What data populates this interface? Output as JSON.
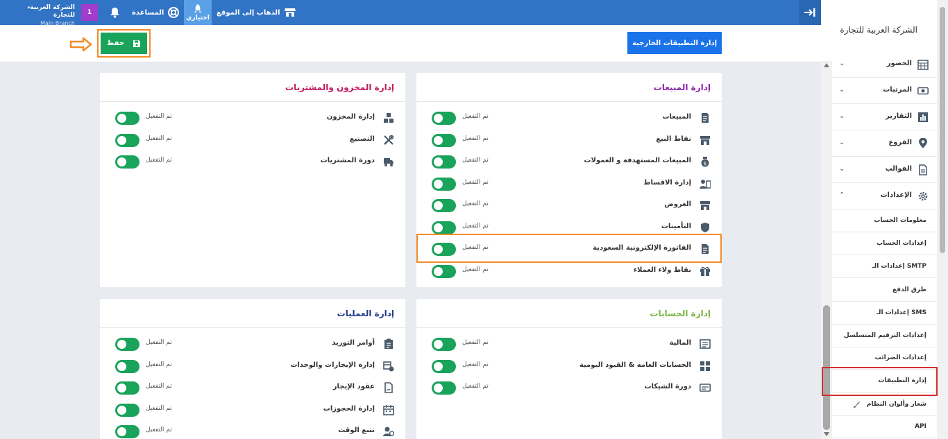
{
  "topbar": {
    "company": "الشركة العربية للتجارة",
    "branch": "Main Branch",
    "badge": "1",
    "help": "المساعدة",
    "mine": "اختياري",
    "goto_site": "الذهاب إلى الموقع"
  },
  "toolbar": {
    "save_label": "حفظ",
    "external_apps_label": "إدارة التطبيقات الخارجية"
  },
  "status_enabled": "تم التفعيل",
  "cards": {
    "sales": {
      "title": "إدارة المبيعات",
      "title_color": "#8e24aa",
      "items": [
        {
          "label": "المبيعات",
          "status": "تم التفعيل",
          "icon": "receipt-icon"
        },
        {
          "label": "نقاط البيع",
          "status": "تم التفعيل",
          "icon": "store-icon"
        },
        {
          "label": "المبيعات المستهدفة و العمولات",
          "status": "تم التفعيل",
          "icon": "money-bag-icon"
        },
        {
          "label": "إدارة الاقساط",
          "status": "تم التفعيل",
          "icon": "installments-icon"
        },
        {
          "label": "العروض",
          "status": "تم التفعيل",
          "icon": "store-icon"
        },
        {
          "label": "التأمينات",
          "status": "تم التفعيل",
          "icon": "shield-icon"
        },
        {
          "label": "الفاتورة الإلكترونية السعودية",
          "status": "تم التفعيل",
          "icon": "invoice-icon"
        },
        {
          "label": "نقاط ولاء العملاء",
          "status": "تم التفعيل",
          "icon": "gift-icon"
        }
      ]
    },
    "inventory": {
      "title": "إدارة المخزون والمشتريات",
      "title_color": "#c2185b",
      "items": [
        {
          "label": "إدارة المخزون",
          "status": "تم التفعيل",
          "icon": "boxes-icon"
        },
        {
          "label": "التصنيع",
          "status": "تم التفعيل",
          "icon": "tools-icon"
        },
        {
          "label": "دورة المشتريات",
          "status": "تم التفعيل",
          "icon": "truck-icon"
        }
      ]
    },
    "accounts": {
      "title": "إدارة الحسابات",
      "title_color": "#7cb342",
      "items": [
        {
          "label": "المالية",
          "status": "تم التفعيل",
          "icon": "finance-icon"
        },
        {
          "label": "الحسابات العامه & القيود اليومية",
          "status": "تم التفعيل",
          "icon": "grid-icon"
        },
        {
          "label": "دورة الشيكات",
          "status": "تم التفعيل",
          "icon": "check-icon"
        }
      ]
    },
    "operations": {
      "title": "إدارة العمليات",
      "title_color": "#1e3a8a",
      "items": [
        {
          "label": "أوامر التوريد",
          "status": "تم التفعيل",
          "icon": "clipboard-icon"
        },
        {
          "label": "إدارة الإيجارات والوحدات",
          "status": "تم التفعيل",
          "icon": "rental-icon"
        },
        {
          "label": "عقود الإيجار",
          "status": "تم التفعيل",
          "icon": "contract-icon"
        },
        {
          "label": "إدارة الحجوزات",
          "status": "تم التفعيل",
          "icon": "calendar-icon"
        },
        {
          "label": "تتبع الوقت",
          "status": "تم التفعيل",
          "icon": "time-user-icon"
        }
      ]
    }
  },
  "sidebar": {
    "company": "الشركة العربية للتجارة",
    "items": [
      {
        "label": "الحضور",
        "icon": "calendar-grid-icon"
      },
      {
        "label": "المرتبات",
        "icon": "cash-icon"
      },
      {
        "label": "التقارير",
        "icon": "bar-chart-icon"
      },
      {
        "label": "الفروع",
        "icon": "location-pin-icon"
      },
      {
        "label": "القوالب",
        "icon": "document-icon"
      },
      {
        "label": "الإعدادات",
        "icon": "gear-icon"
      }
    ],
    "sub_items": [
      {
        "label": "معلومات الحساب"
      },
      {
        "label": "إعدادات الحساب"
      },
      {
        "label": "إعدادات الـ SMTP"
      },
      {
        "label": "طرق الدفع"
      },
      {
        "label": "إعدادات الـ SMS"
      },
      {
        "label": "إعدادات الترقيم المتسلسل"
      },
      {
        "label": "إعدادات الضرائب"
      },
      {
        "label": "إدارة التطبيقات"
      },
      {
        "label": "شعار وألوان النظام"
      },
      {
        "label": "API"
      }
    ]
  },
  "colors": {
    "topbar": "#3173c4",
    "save_button": "#1aa35a",
    "external_button": "#1a73e8",
    "toggle_on": "#1aa35a",
    "highlight_orange": "#f28c28",
    "highlight_red": "#d32f2f",
    "badge": "#a13ccf"
  }
}
